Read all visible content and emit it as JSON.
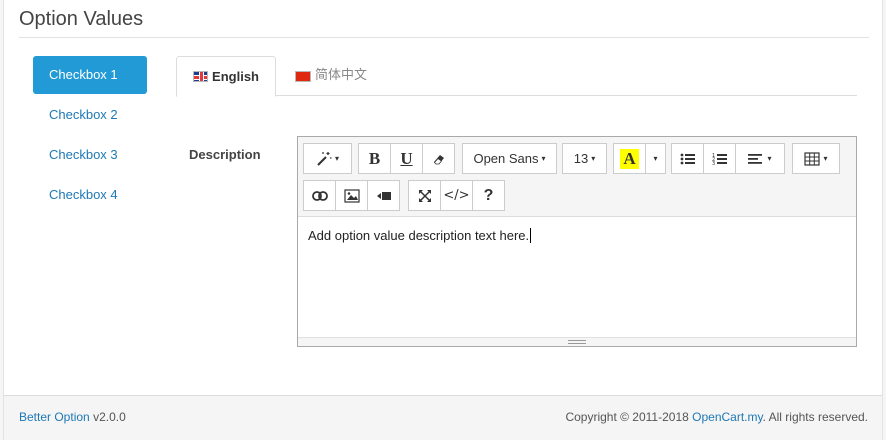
{
  "page": {
    "title": "Option Values"
  },
  "option_tabs": [
    {
      "label": "Checkbox 1",
      "active": true
    },
    {
      "label": "Checkbox 2",
      "active": false
    },
    {
      "label": "Checkbox 3",
      "active": false
    },
    {
      "label": "Checkbox 4",
      "active": false
    }
  ],
  "language_tabs": [
    {
      "label": "English",
      "flag": "flag-gb-icon",
      "active": true
    },
    {
      "label": "简体中文",
      "flag": "flag-cn-icon",
      "active": false
    }
  ],
  "form": {
    "description_label": "Description"
  },
  "toolbar": {
    "font_name": "Open Sans",
    "font_size": "13",
    "highlight_letter": "A",
    "bold": "B",
    "underline": "U",
    "help": "?"
  },
  "editor": {
    "content": "Add option value description text here."
  },
  "footer": {
    "product_link": "Better Option",
    "version": "v2.0.0",
    "copyright_prefix": "Copyright © 2011-2018",
    "company_link": "OpenCart.my",
    "copyright_suffix": ". All rights reserved."
  },
  "colors": {
    "accent": "#229ad6",
    "link": "#1e78b4",
    "highlight": "#ffff00"
  }
}
